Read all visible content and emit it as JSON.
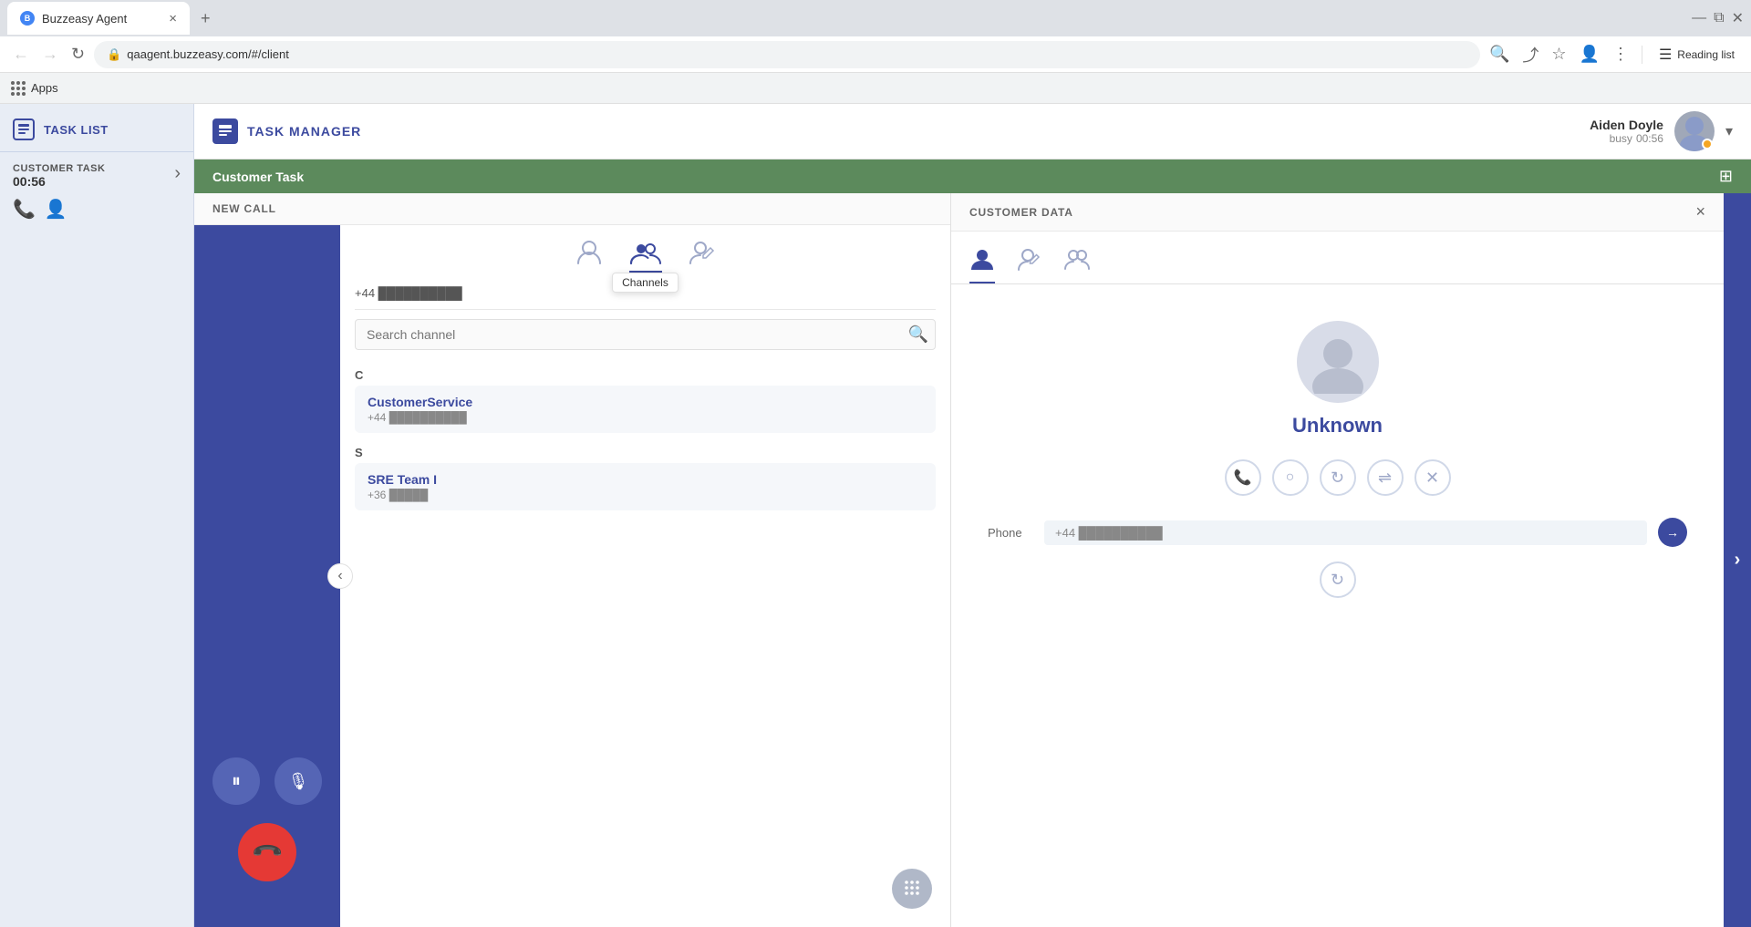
{
  "browser": {
    "tab_title": "Buzzeasy Agent",
    "tab_close": "×",
    "new_tab": "+",
    "url": "qaagent.buzzeasy.com/#/client",
    "reading_list": "Reading list",
    "apps_label": "Apps",
    "nav_controls": [
      "minimize",
      "maximize",
      "close"
    ]
  },
  "sidebar": {
    "task_list_label": "TASK LIST",
    "customer_task_label": "CUSTOMER TASK",
    "customer_task_timer": "00:56"
  },
  "task_manager": {
    "label": "TASK MANAGER",
    "agent_name": "Aiden Doyle",
    "agent_status": "busy",
    "agent_timer": "00:56"
  },
  "customer_task_bar": {
    "label": "Customer Task",
    "icon": "⊞"
  },
  "new_call": {
    "header": "NEW CALL",
    "phone_number": "+44 ██████████",
    "pause_label": "⏸",
    "mute_label": "🎤",
    "hangup_label": "📞"
  },
  "channels": {
    "tooltip": "Channels",
    "search_placeholder": "Search channel",
    "phone_number_row": "+44 ██████████",
    "letter_c": "C",
    "letter_s": "S",
    "items": [
      {
        "name": "CustomerService",
        "number": "+44 ██████████"
      },
      {
        "name": "SRE Team I",
        "number": "+36 █████"
      }
    ]
  },
  "customer_data": {
    "header": "CUSTOMER DATA",
    "close_label": "×",
    "customer_name": "Unknown",
    "phone_label": "Phone",
    "phone_number": "+44 ██████████"
  },
  "icons": {
    "search": "🔍",
    "phone": "📞",
    "person": "👤",
    "people": "👥",
    "edit_person": "✏️",
    "keypad": "⌨",
    "chevron_left": "‹",
    "chevron_right": "›",
    "lock": "🔒",
    "back": "←",
    "forward": "→",
    "refresh": "↻",
    "star": "☆",
    "user_circle": "👤",
    "more": "⋮",
    "reading_list": "☰",
    "pause": "⏸",
    "mic": "🎙",
    "close": "×",
    "grid": "⊞"
  }
}
